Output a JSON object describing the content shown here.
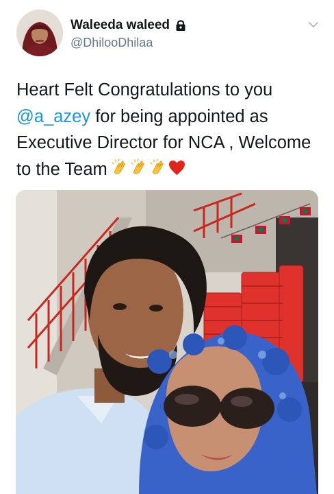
{
  "author": {
    "display_name": "Waleeda waleed",
    "handle": "@DhilooDhilaa",
    "protected_icon": "lock-icon",
    "avatar": "profile-photo"
  },
  "menu": {
    "icon": "chevron-down-icon"
  },
  "tweet": {
    "line1": "Heart Felt Congratulations to you",
    "mention": "@a_azey",
    "line2_rest": " for being appointed as",
    "line3": "Executive Director for NCA , Welcome",
    "line4": "to the Team",
    "emojis": [
      "clapping-hands-icon",
      "clapping-hands-icon",
      "clapping-hands-icon",
      "red-heart-icon"
    ]
  },
  "media": {
    "type": "photo",
    "subject": "selfie-photo"
  },
  "colors": {
    "text": "#14171a",
    "secondary": "#657786",
    "link": "#1b95e0",
    "railing_red": "#c8281f",
    "chair_red": "#e0322c",
    "hijab_blue": "#3a63c9"
  }
}
